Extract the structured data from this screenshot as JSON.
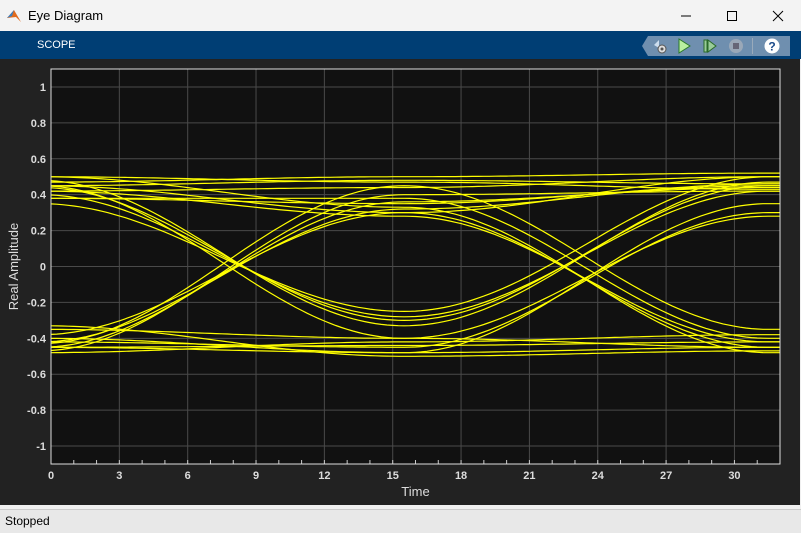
{
  "window": {
    "title": "Eye Diagram"
  },
  "tab": {
    "label": "SCOPE"
  },
  "status": {
    "text": "Stopped"
  },
  "colors": {
    "trace": "#ffff00",
    "axes_bg": "#111111",
    "grid": "#4a4a4a"
  },
  "chart_data": {
    "type": "line",
    "xlabel": "Time",
    "ylabel": "Real Amplitude",
    "xlim": [
      0,
      32
    ],
    "ylim": [
      -1.1,
      1.1
    ],
    "xticks": [
      0,
      3,
      6,
      9,
      12,
      15,
      18,
      21,
      24,
      27,
      30
    ],
    "yticks": [
      1,
      0.8,
      0.6,
      0.4,
      0.2,
      0,
      -0.2,
      -0.4,
      -0.6,
      -0.8,
      -1
    ],
    "grid": true,
    "symbol_times": [
      -0.5,
      15.5,
      31.5
    ],
    "traces": [
      [
        0.45,
        0.48,
        0.46
      ],
      [
        0.42,
        0.44,
        0.5
      ],
      [
        0.5,
        0.47,
        0.43
      ],
      [
        0.38,
        0.35,
        0.45
      ],
      [
        0.47,
        0.5,
        0.52
      ],
      [
        0.44,
        -0.3,
        0.45
      ],
      [
        0.4,
        -0.28,
        0.42
      ],
      [
        0.48,
        -0.33,
        0.47
      ],
      [
        0.35,
        -0.25,
        0.5
      ],
      [
        0.45,
        0.3,
        -0.45
      ],
      [
        0.42,
        0.28,
        -0.42
      ],
      [
        0.5,
        0.33,
        -0.48
      ],
      [
        0.38,
        0.38,
        -0.4
      ],
      [
        -0.42,
        0.32,
        0.46
      ],
      [
        -0.45,
        0.36,
        0.44
      ],
      [
        -0.38,
        0.3,
        0.5
      ],
      [
        -0.47,
        0.4,
        0.42
      ],
      [
        -0.42,
        -0.45,
        0.3
      ],
      [
        -0.35,
        -0.4,
        0.28
      ],
      [
        -0.45,
        -0.48,
        0.35
      ],
      [
        -0.45,
        -0.44,
        -0.42
      ],
      [
        -0.4,
        -0.48,
        -0.45
      ],
      [
        -0.48,
        -0.42,
        -0.38
      ],
      [
        -0.33,
        -0.5,
        -0.47
      ],
      [
        0.45,
        -0.4,
        -0.45
      ],
      [
        -0.43,
        0.45,
        -0.35
      ]
    ]
  }
}
